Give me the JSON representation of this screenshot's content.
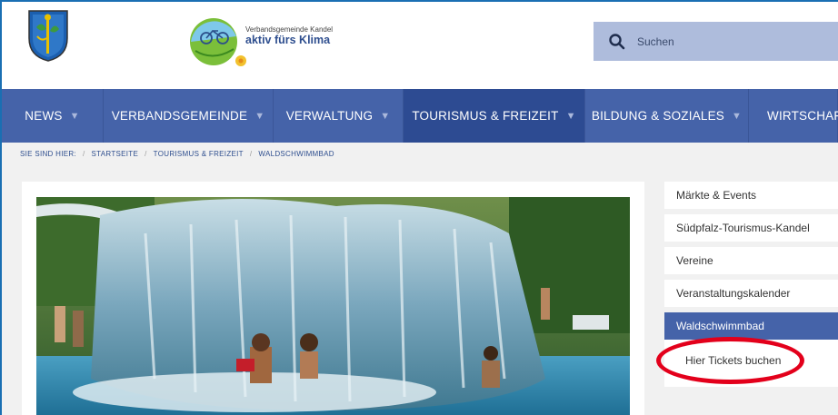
{
  "header": {
    "logo_small": "Verbandsgemeinde Kandel",
    "logo_big": "aktiv fürs Klima",
    "search_placeholder": "Suchen"
  },
  "nav": {
    "items": [
      {
        "label": "NEWS",
        "active": false
      },
      {
        "label": "VERBANDSGEMEINDE",
        "active": false
      },
      {
        "label": "VERWALTUNG",
        "active": false
      },
      {
        "label": "TOURISMUS & FREIZEIT",
        "active": true
      },
      {
        "label": "BILDUNG & SOZIALES",
        "active": false
      },
      {
        "label": "WIRTSCHAFT",
        "active": false
      }
    ]
  },
  "breadcrumb": {
    "prefix": "SIE SIND HIER:",
    "items": [
      "STARTSEITE",
      "TOURISMUS & FREIZEIT",
      "WALDSCHWIMMBAD"
    ]
  },
  "sidebar": {
    "items": [
      {
        "label": "Märkte & Events"
      },
      {
        "label": "Südpfalz-Tourismus-Kandel"
      },
      {
        "label": "Vereine"
      },
      {
        "label": "Veranstaltungskalender"
      },
      {
        "label": "Waldschwimmbad"
      }
    ],
    "sub_link": "Hier Tickets buchen"
  },
  "colors": {
    "nav_bg": "#4563a9",
    "nav_active": "#2d4b92",
    "search_bg": "#aebcdc",
    "highlight_circle": "#e3001b"
  }
}
